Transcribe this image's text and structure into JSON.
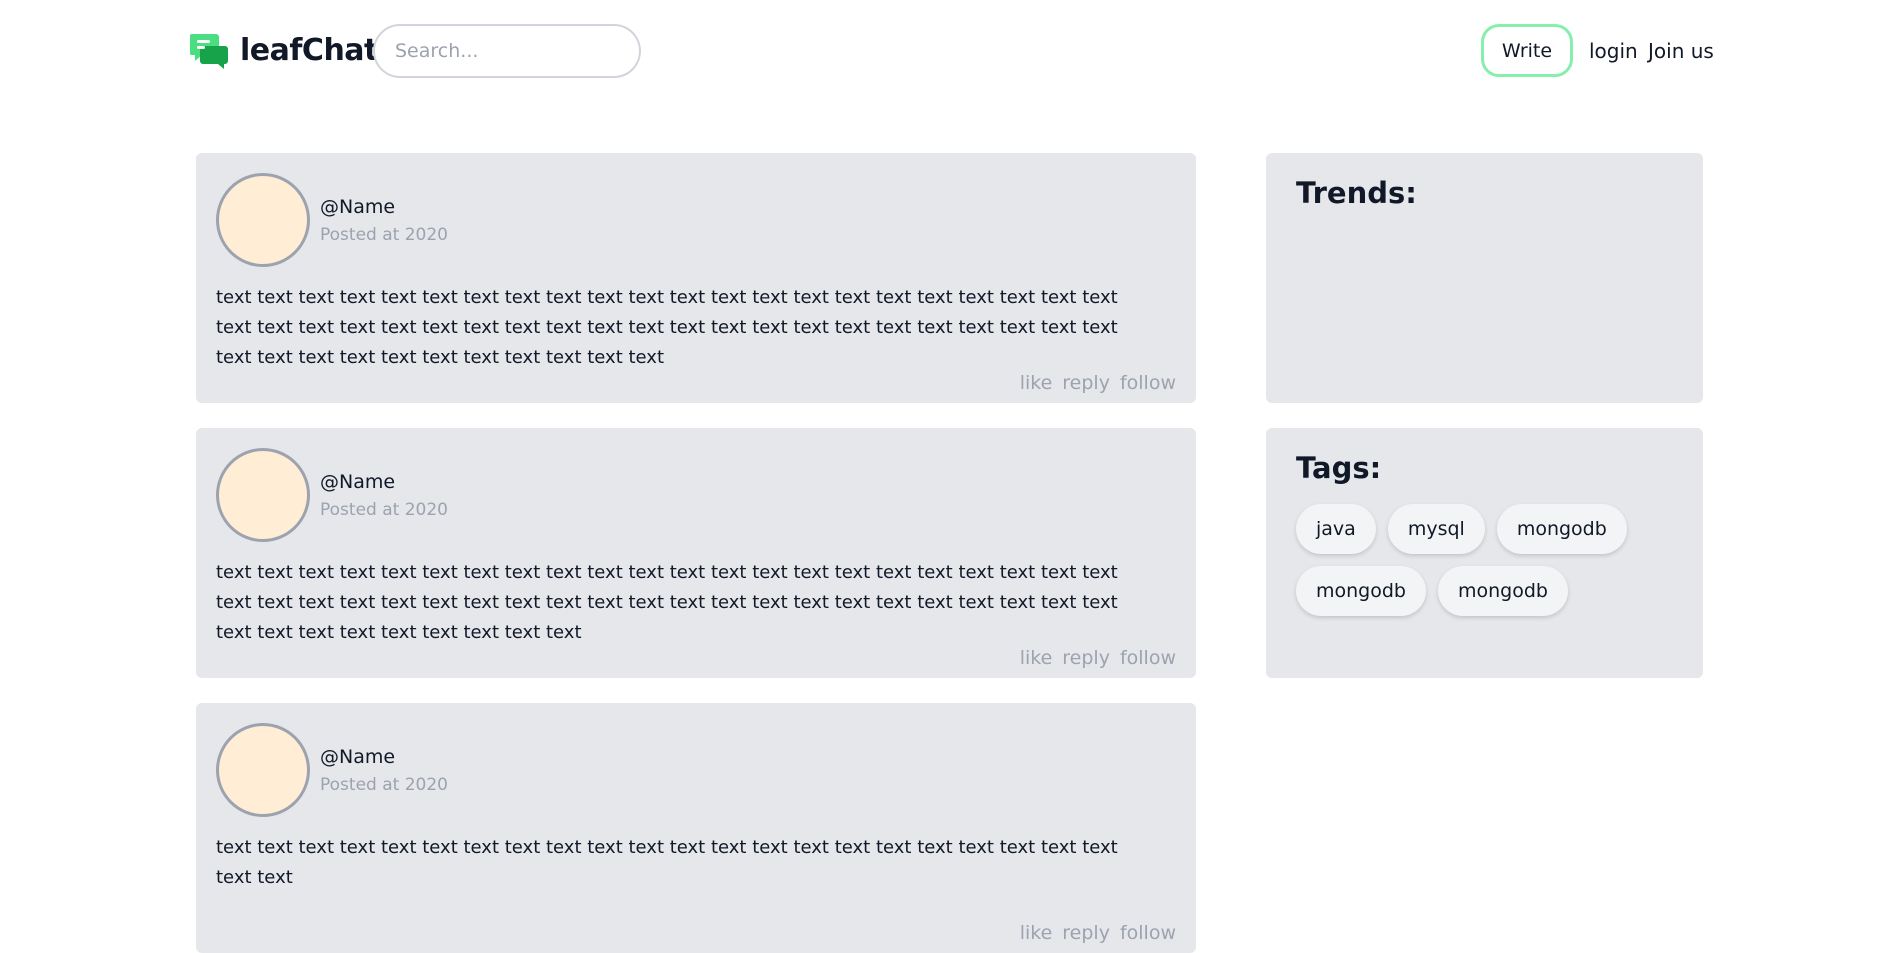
{
  "header": {
    "brand": "leafChat",
    "search_placeholder": "Search...",
    "write_label": "Write",
    "login_label": "login",
    "join_label": "Join us"
  },
  "posts": [
    {
      "name": "@Name",
      "time": "Posted at 2020",
      "body": "text text text text text text text text text text text text text text text text text text text text text text text text text text text text text text text text text text text text text text text text text text text text text text text text text text text text text text text",
      "actions": [
        "like",
        "reply",
        "follow"
      ]
    },
    {
      "name": "@Name",
      "time": "Posted at 2020",
      "body": "text text text text text text text text text text text text text text text text text text text text text text text text text text text text text text text text text text text text text text text text text text text text text text text text text text text text text",
      "actions": [
        "like",
        "reply",
        "follow"
      ]
    },
    {
      "name": "@Name",
      "time": "Posted at 2020",
      "body": "text text text text text text text text text text text text text text text text text text text text text text text text",
      "actions": [
        "like",
        "reply",
        "follow"
      ]
    }
  ],
  "sidebar": {
    "trends_title": "Trends:",
    "tags_title": "Tags:",
    "tags": [
      "java",
      "mysql",
      "mongodb",
      "mongodb",
      "mongodb"
    ]
  },
  "colors": {
    "card_bg": "#e5e7eb",
    "avatar_fill": "#ffedd5",
    "write_border": "#86efac",
    "muted_text": "#9ca3af",
    "logo_green": "#22c55e"
  },
  "icons": {
    "logo": "chat-bubbles-icon"
  }
}
